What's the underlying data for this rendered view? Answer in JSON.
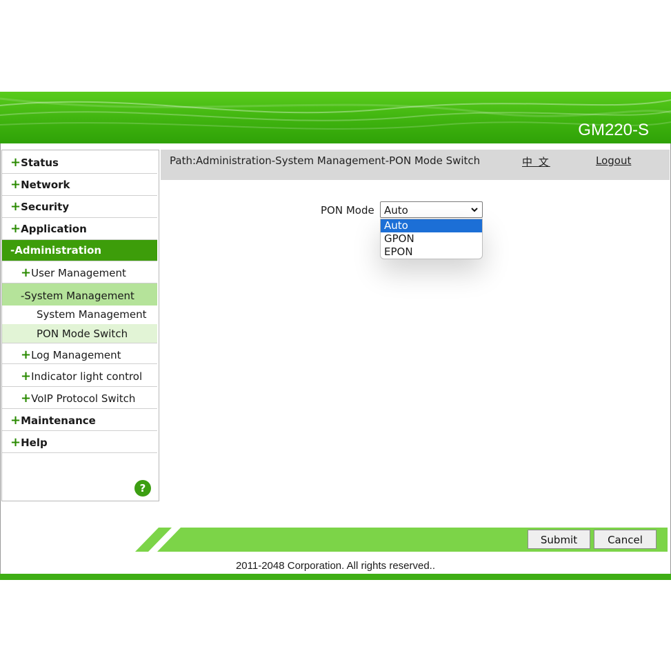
{
  "header": {
    "product": "GM220-S"
  },
  "path": {
    "text": "Path:Administration-System Management-PON Mode Switch",
    "language": "中 文",
    "logout": "Logout"
  },
  "menu": {
    "plus": "+",
    "minus": "-",
    "status": "Status",
    "network": "Network",
    "security": "Security",
    "application": "Application",
    "administration": "Administration",
    "user_management": "User Management",
    "system_management": "System Management",
    "system_management_sub": "System Management",
    "pon_mode_switch": "PON Mode Switch",
    "log_management": "Log Management",
    "indicator_light": "Indicator light control",
    "voip_switch": "VoIP Protocol Switch",
    "maintenance": "Maintenance",
    "help": "Help"
  },
  "help_icon": {
    "glyph": "?"
  },
  "form": {
    "pon_mode_label": "PON Mode",
    "pon_mode_value": "Auto",
    "options": [
      "Auto",
      "GPON",
      "EPON"
    ]
  },
  "buttons": {
    "submit": "Submit",
    "cancel": "Cancel"
  },
  "footer": {
    "copyright": "2011-2048 Corporation. All rights reserved.."
  },
  "colors": {
    "brand_green": "#3fae15",
    "menu_active": "#3d9d0a",
    "option_selected": "#1c6fd6"
  }
}
